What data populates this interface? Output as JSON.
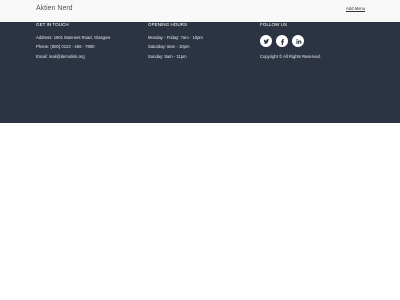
{
  "header": {
    "brand": "Aktien Nerd",
    "menu_link": "Add Menu"
  },
  "footer": {
    "contact": {
      "heading": "GET IN TOUCH",
      "address": "Address: 1901 Manners Road, Glasgow",
      "phone": "Phone: (800) 0123 - 456 - 7890",
      "email": "Email: mail@demolink.org"
    },
    "hours": {
      "heading": "OPENING HOURS",
      "weekdays": "Monday - Friday: 7am - 10pm",
      "saturday": "Saturday: 8am - 10pm",
      "sunday": "Sunday: 8am - 11pm"
    },
    "social": {
      "heading": "FOLLOW US",
      "icons": [
        "twitter-icon",
        "facebook-icon",
        "linkedin-icon"
      ],
      "copyright": "Copyright © All Rights Reserved."
    }
  },
  "colors": {
    "footer_bg": "#2c3443",
    "header_bg": "#f8f8f8",
    "icon_fg": "#2c3443"
  }
}
